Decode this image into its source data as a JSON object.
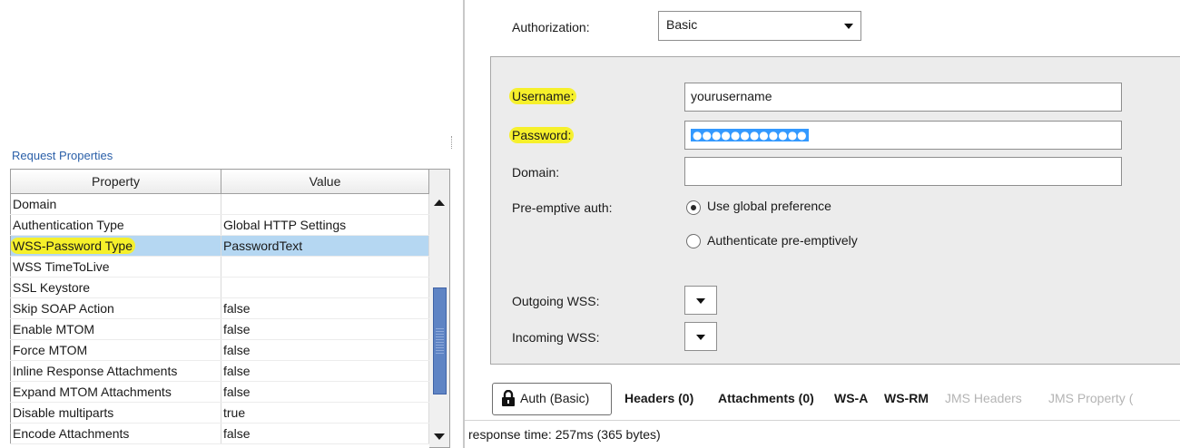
{
  "left": {
    "title": "Request Properties",
    "columns": [
      "Property",
      "Value"
    ],
    "rows": [
      {
        "property": "Domain",
        "value": ""
      },
      {
        "property": "Authentication Type",
        "value": "Global HTTP Settings"
      },
      {
        "property": "WSS-Password Type",
        "value": "PasswordText",
        "selected": true,
        "highlighted": true
      },
      {
        "property": "WSS TimeToLive",
        "value": ""
      },
      {
        "property": "SSL Keystore",
        "value": ""
      },
      {
        "property": "Skip SOAP Action",
        "value": "false"
      },
      {
        "property": "Enable MTOM",
        "value": "false"
      },
      {
        "property": "Force MTOM",
        "value": "false"
      },
      {
        "property": "Inline Response Attachments",
        "value": "false"
      },
      {
        "property": "Expand MTOM Attachments",
        "value": "false"
      },
      {
        "property": "Disable multiparts",
        "value": "true"
      },
      {
        "property": "Encode Attachments",
        "value": "false"
      }
    ]
  },
  "auth": {
    "label": "Authorization:",
    "selected": "Basic",
    "username_label": "Username:",
    "username_value": "yourusername",
    "password_label": "Password:",
    "password_masked": "●●●●●●●●●●●●",
    "domain_label": "Domain:",
    "domain_value": "",
    "preemptive_label": "Pre-emptive auth:",
    "radio_options": [
      {
        "label": "Use global preference",
        "checked": true
      },
      {
        "label": "Authenticate pre-emptively",
        "checked": false
      }
    ],
    "outgoing_label": "Outgoing WSS:",
    "incoming_label": "Incoming WSS:"
  },
  "tabs": [
    {
      "label": "Auth (Basic)",
      "active": true,
      "icon": "lock-icon"
    },
    {
      "label": "Headers (0)"
    },
    {
      "label": "Attachments (0)"
    },
    {
      "label": "WS-A"
    },
    {
      "label": "WS-RM"
    },
    {
      "label": "JMS Headers",
      "disabled": true
    },
    {
      "label": "JMS Property (",
      "disabled": true
    }
  ],
  "status": "response time: 257ms (365 bytes)",
  "colors": {
    "highlight": "#f6f02a",
    "selection": "#b5d7f2",
    "accent": "#2a5fa8"
  }
}
